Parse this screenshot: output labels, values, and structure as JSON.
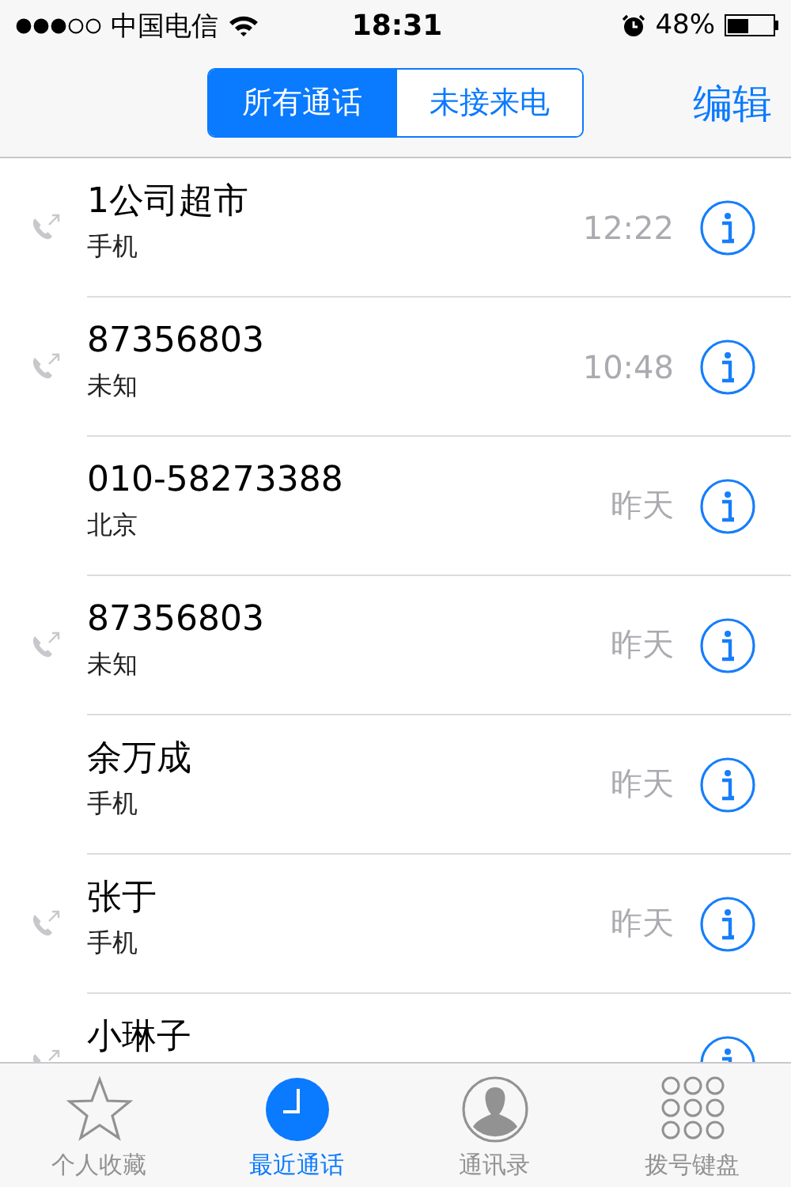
{
  "status_bar": {
    "carrier": "中国电信",
    "time": "18:31",
    "battery_text": "48%"
  },
  "segments": [
    {
      "label": "所有通话",
      "selected": true
    },
    {
      "label": "未接来电",
      "selected": false
    }
  ],
  "edit_button": "编辑",
  "calls": [
    {
      "name": "1公司超市",
      "detail": "手机",
      "time": "12:22",
      "outgoing": true
    },
    {
      "name": "87356803",
      "detail": "未知",
      "time": "10:48",
      "outgoing": true
    },
    {
      "name": "010-58273388",
      "detail": "北京",
      "time": "昨天",
      "outgoing": false
    },
    {
      "name": "87356803",
      "detail": "未知",
      "time": "昨天",
      "outgoing": true
    },
    {
      "name": "余万成",
      "detail": "手机",
      "time": "昨天",
      "outgoing": false
    },
    {
      "name": "张于",
      "detail": "手机",
      "time": "昨天",
      "outgoing": true
    },
    {
      "name": "小琳子",
      "outgoing": true
    }
  ],
  "tab_bar": [
    {
      "kind": "favorites",
      "label": "个人收藏",
      "selected": false
    },
    {
      "kind": "recents",
      "label": "最近通话",
      "selected": true
    },
    {
      "kind": "contacts",
      "label": "通讯录",
      "selected": false
    },
    {
      "kind": "keypad",
      "label": "拨号键盘",
      "selected": false
    }
  ]
}
